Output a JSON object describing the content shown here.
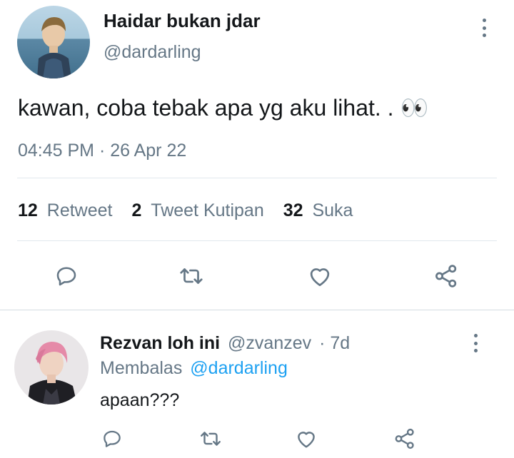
{
  "tweet": {
    "author_name": "Haidar bukan jdar",
    "author_handle": "@dardarling",
    "text": "kawan, coba tebak apa yg aku lihat. . 👀",
    "timestamp": "04:45 PM · 26 Apr 22",
    "stats": {
      "retweets_count": "12",
      "retweets_label": "Retweet",
      "quotes_count": "2",
      "quotes_label": "Tweet Kutipan",
      "likes_count": "32",
      "likes_label": "Suka"
    },
    "actions": [
      "reply-icon",
      "retweet-icon",
      "like-icon",
      "share-icon"
    ]
  },
  "reply": {
    "author_name": "Rezvan loh ini",
    "author_handle": "@zvanzev",
    "age": "· 7d",
    "replying_label": "Membalas",
    "replying_to": "@dardarling",
    "text": "apaan???",
    "actions": [
      "reply-icon",
      "retweet-icon",
      "like-icon",
      "share-icon"
    ]
  },
  "colors": {
    "text": "#14171a",
    "muted": "#657786",
    "link": "#1da1f2",
    "divider": "#e1e8ed"
  }
}
